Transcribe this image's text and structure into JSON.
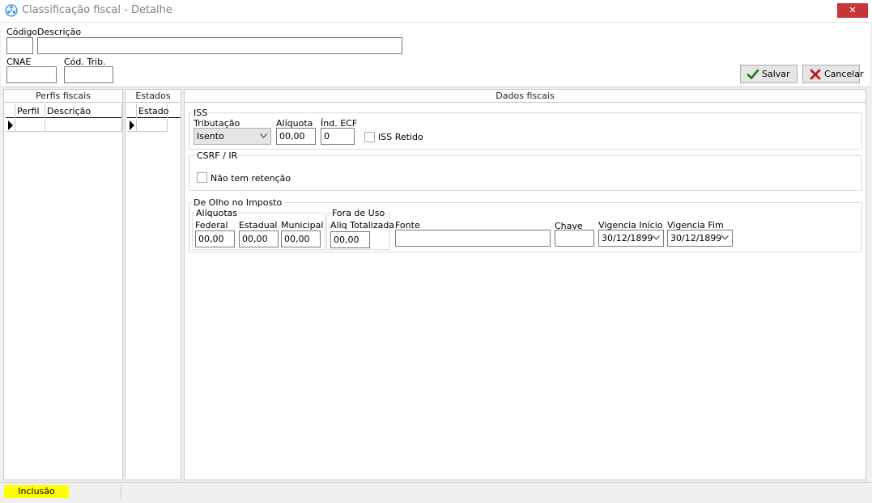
{
  "window": {
    "title": "Classificação fiscal - Detalhe",
    "close_glyph": "✕",
    "icon": "snowflake-app-icon"
  },
  "form": {
    "codigo_label": "Código",
    "codigo_value": "",
    "descricao_label": "Descrição",
    "descricao_value": "",
    "cnae_label": "CNAE",
    "cnae_value": "",
    "cod_trib_label": "Cód. Trib.",
    "cod_trib_value": ""
  },
  "toolbar": {
    "save_label": "Salvar",
    "cancel_label": "Cancelar",
    "save_color": "#1a7a1a",
    "cancel_color": "#c01818"
  },
  "perfis": {
    "title": "Perfis fiscais",
    "columns": [
      "Perfil",
      "Descrição"
    ]
  },
  "estados": {
    "title": "Estados",
    "columns": [
      "Estado"
    ]
  },
  "dados": {
    "title": "Dados fiscais",
    "iss": {
      "group": "ISS",
      "tributacao_label": "Tributação",
      "tributacao_value": "Isento",
      "aliquota_label": "Alíquota",
      "aliquota_value": "00,00",
      "ind_ecf_label": "Índ. ECF",
      "ind_ecf_value": "0",
      "iss_retido_label": "ISS Retido",
      "iss_retido_checked": false
    },
    "csrf": {
      "group": "CSRF / IR",
      "nao_retencao_label": "Não tem retenção",
      "nao_retencao_checked": false
    },
    "olho": {
      "group": "De Olho no Imposto",
      "aliquotas_group": "Alíquotas",
      "federal_label": "Federal",
      "federal_value": "00,00",
      "estadual_label": "Estadual",
      "estadual_value": "00,00",
      "municipal_label": "Municipal",
      "municipal_value": "00,00",
      "fora_uso_group": "Fora de Uso",
      "aliq_totalizada_label": "Aliq Totalizada",
      "aliq_totalizada_value": "00,00",
      "fonte_label": "Fonte",
      "fonte_value": "",
      "chave_label": "Chave",
      "chave_value": "",
      "vigencia_inicio_label": "Vigencia Início",
      "vigencia_inicio_value": "30/12/1899",
      "vigencia_fim_label": "Vigencia Fim",
      "vigencia_fim_value": "30/12/1899"
    }
  },
  "status": {
    "mode": "Inclusão",
    "mode_color": "#ffff00"
  }
}
